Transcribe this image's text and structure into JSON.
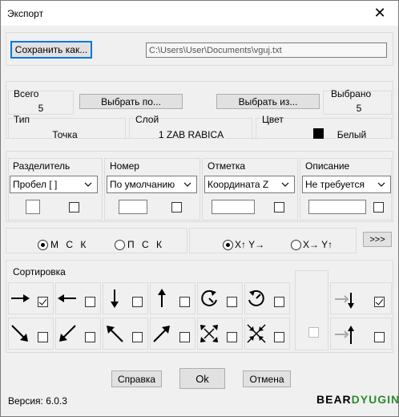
{
  "window": {
    "title": "Экспорт",
    "close_glyph": "✕"
  },
  "save": {
    "button_label": "Сохранить как...",
    "path": "C:\\Users\\User\\Documents\\vguj.txt"
  },
  "selection": {
    "total_label": "Всего",
    "total_value": "5",
    "select_by_label": "Выбрать по...",
    "select_from_label": "Выбрать из...",
    "selected_label": "Выбрано",
    "selected_value": "5"
  },
  "props": {
    "type_label": "Тип",
    "type_value": "Точка",
    "layer_label": "Слой",
    "layer_value": "1 ZAB RABICA",
    "color_label": "Цвет",
    "color_value": "Белый",
    "color_swatch": "#000000"
  },
  "columns": [
    {
      "label": "Разделитель",
      "value": "Пробел [  ]"
    },
    {
      "label": "Номер",
      "value": "По умолчанию"
    },
    {
      "label": "Отметка",
      "value": "Координата Z"
    },
    {
      "label": "Описание",
      "value": "Не требуется"
    }
  ],
  "coords": {
    "msk_label": "М С К",
    "psk_label": "П С К",
    "xy_label": "X↑ Y→",
    "yx_label": "X→ Y↑",
    "more_label": ">>>",
    "msk_selected": true,
    "xy_selected": true
  },
  "sort": {
    "label": "Сортировка",
    "icons": [
      "arrow-right-icon",
      "arrow-left-icon",
      "arrow-down-icon",
      "arrow-up-icon",
      "rotate-ccw-icon",
      "rotate-cw-icon",
      "arrow-down-right-icon",
      "arrow-down-left-icon",
      "arrow-up-left-icon",
      "arrow-up-right-icon",
      "expand-arrows-icon",
      "collapse-arrows-icon"
    ],
    "first_checked": true,
    "extra_top_checked": true
  },
  "footer": {
    "help_label": "Справка",
    "ok_label": "Ok",
    "cancel_label": "Отмена",
    "version": "Версия: 6.0.3",
    "logo": "BEARDYUGIN"
  },
  "colors": {
    "logo_green": "#2e8b2e",
    "accent": "#0078d7"
  }
}
